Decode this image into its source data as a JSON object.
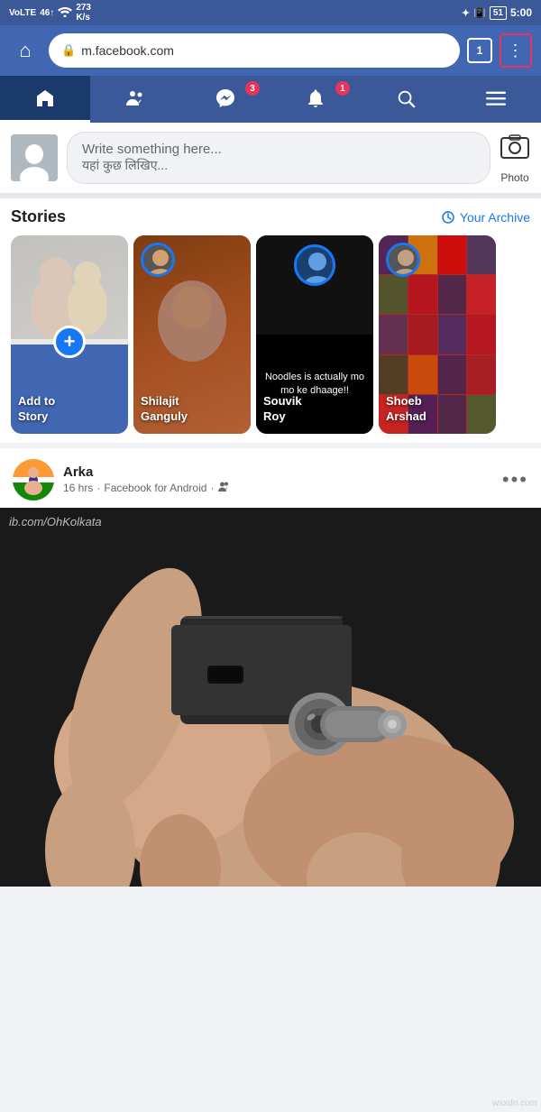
{
  "statusBar": {
    "left": "VoLTE  46↑  273 K/s",
    "rightIcons": "bluetooth  battery:51  5:00"
  },
  "browserBar": {
    "homeIcon": "⌂",
    "lockIcon": "🔒",
    "url": "m.facebook.com",
    "tabCount": "1",
    "menuDots": "⋮"
  },
  "fbNavbar": {
    "homeIcon": "⊞",
    "friendsIcon": "👥",
    "messengerIcon": "💬",
    "messengerBadge": "3",
    "notificationsIcon": "🔔",
    "notificationsBadge": "1",
    "searchIcon": "🔍",
    "menuIcon": "☰"
  },
  "composer": {
    "placeholderEn": "Write something here...",
    "placeholderHi": "यहां कुछ लिखिए...",
    "photoLabel": "Photo"
  },
  "stories": {
    "title": "Stories",
    "archiveLabel": "Your Archive",
    "archiveIcon": "↺",
    "cards": [
      {
        "name": "Add to\nStory",
        "type": "add"
      },
      {
        "name": "Shilajit\nGanguly",
        "type": "person",
        "bgClass": "story-shilajit"
      },
      {
        "name": "Souvik\nRoy",
        "type": "person",
        "bgClass": "story-souvik",
        "storyText": "Noodles is actually mo mo ke dhaage!!"
      },
      {
        "name": "Shoeb\nArshad",
        "type": "person",
        "bgClass": "story-shoeb"
      }
    ]
  },
  "post": {
    "authorName": "Arka",
    "timeAgo": "16 hrs",
    "platform": "Facebook for Android",
    "audienceIcon": "👥",
    "menuDots": "•••",
    "watermark": "ib.com/OhKolkata",
    "imageAlt": "Close up of electronic connector held by hand"
  },
  "footer": {
    "watermark": "wsxdn.com"
  }
}
